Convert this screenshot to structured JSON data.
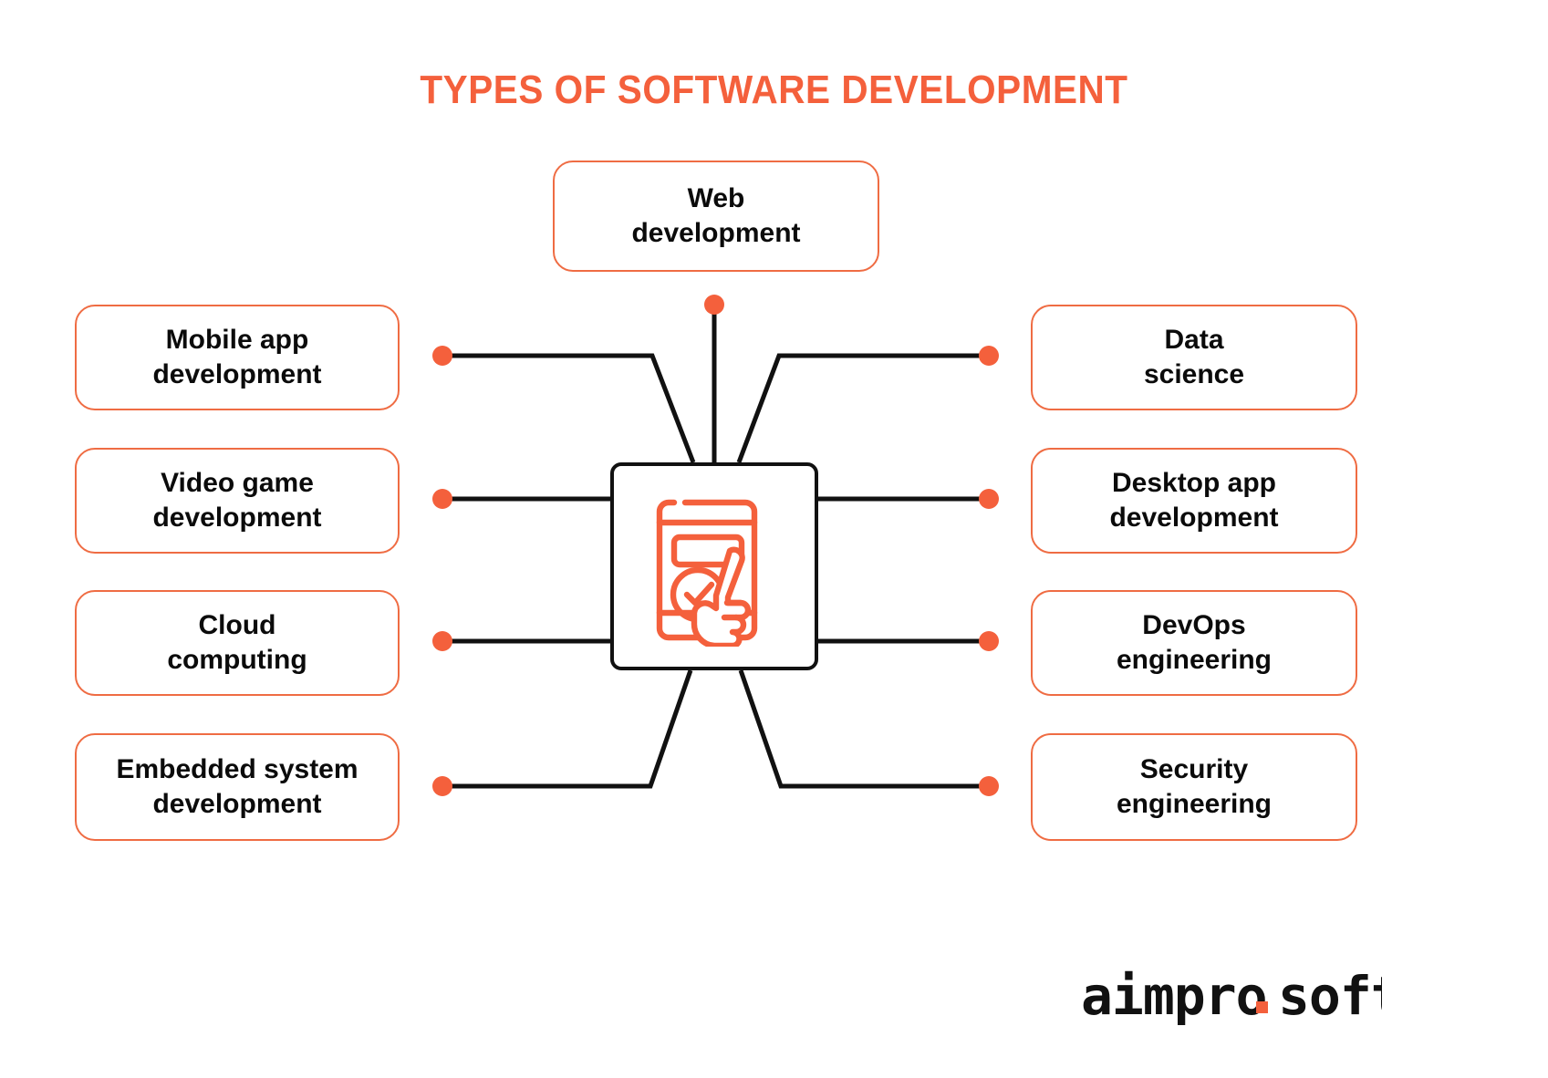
{
  "page": {
    "title": "TYPES OF SOFTWARE DEVELOPMENT",
    "background_color": "#ffffff",
    "accent_color": "#f4603c",
    "box_border_color": "#ef6c43",
    "line_color": "#111111",
    "text_color": "#0b0b0b"
  },
  "center": {
    "icon_name": "mobile-app-touch-icon",
    "icon_color": "#f4603c"
  },
  "nodes": {
    "top": {
      "label": "Web\ndevelopment",
      "name": "web-development"
    },
    "left": [
      {
        "label": "Mobile app\ndevelopment",
        "name": "mobile-app-development"
      },
      {
        "label": "Video game\ndevelopment",
        "name": "video-game-development"
      },
      {
        "label": "Cloud\ncomputing",
        "name": "cloud-computing"
      },
      {
        "label": "Embedded system\ndevelopment",
        "name": "embedded-system-development"
      }
    ],
    "right": [
      {
        "label": "Data\nscience",
        "name": "data-science"
      },
      {
        "label": "Desktop app\ndevelopment",
        "name": "desktop-app-development"
      },
      {
        "label": "DevOps\nengineering",
        "name": "devops-engineering"
      },
      {
        "label": "Security\nengineering",
        "name": "security-engineering"
      }
    ]
  },
  "logo": {
    "text_primary": "aimpro",
    "text_dot": ".",
    "text_secondary": "soft",
    "dot_color": "#f4603c",
    "text_color": "#111111"
  }
}
